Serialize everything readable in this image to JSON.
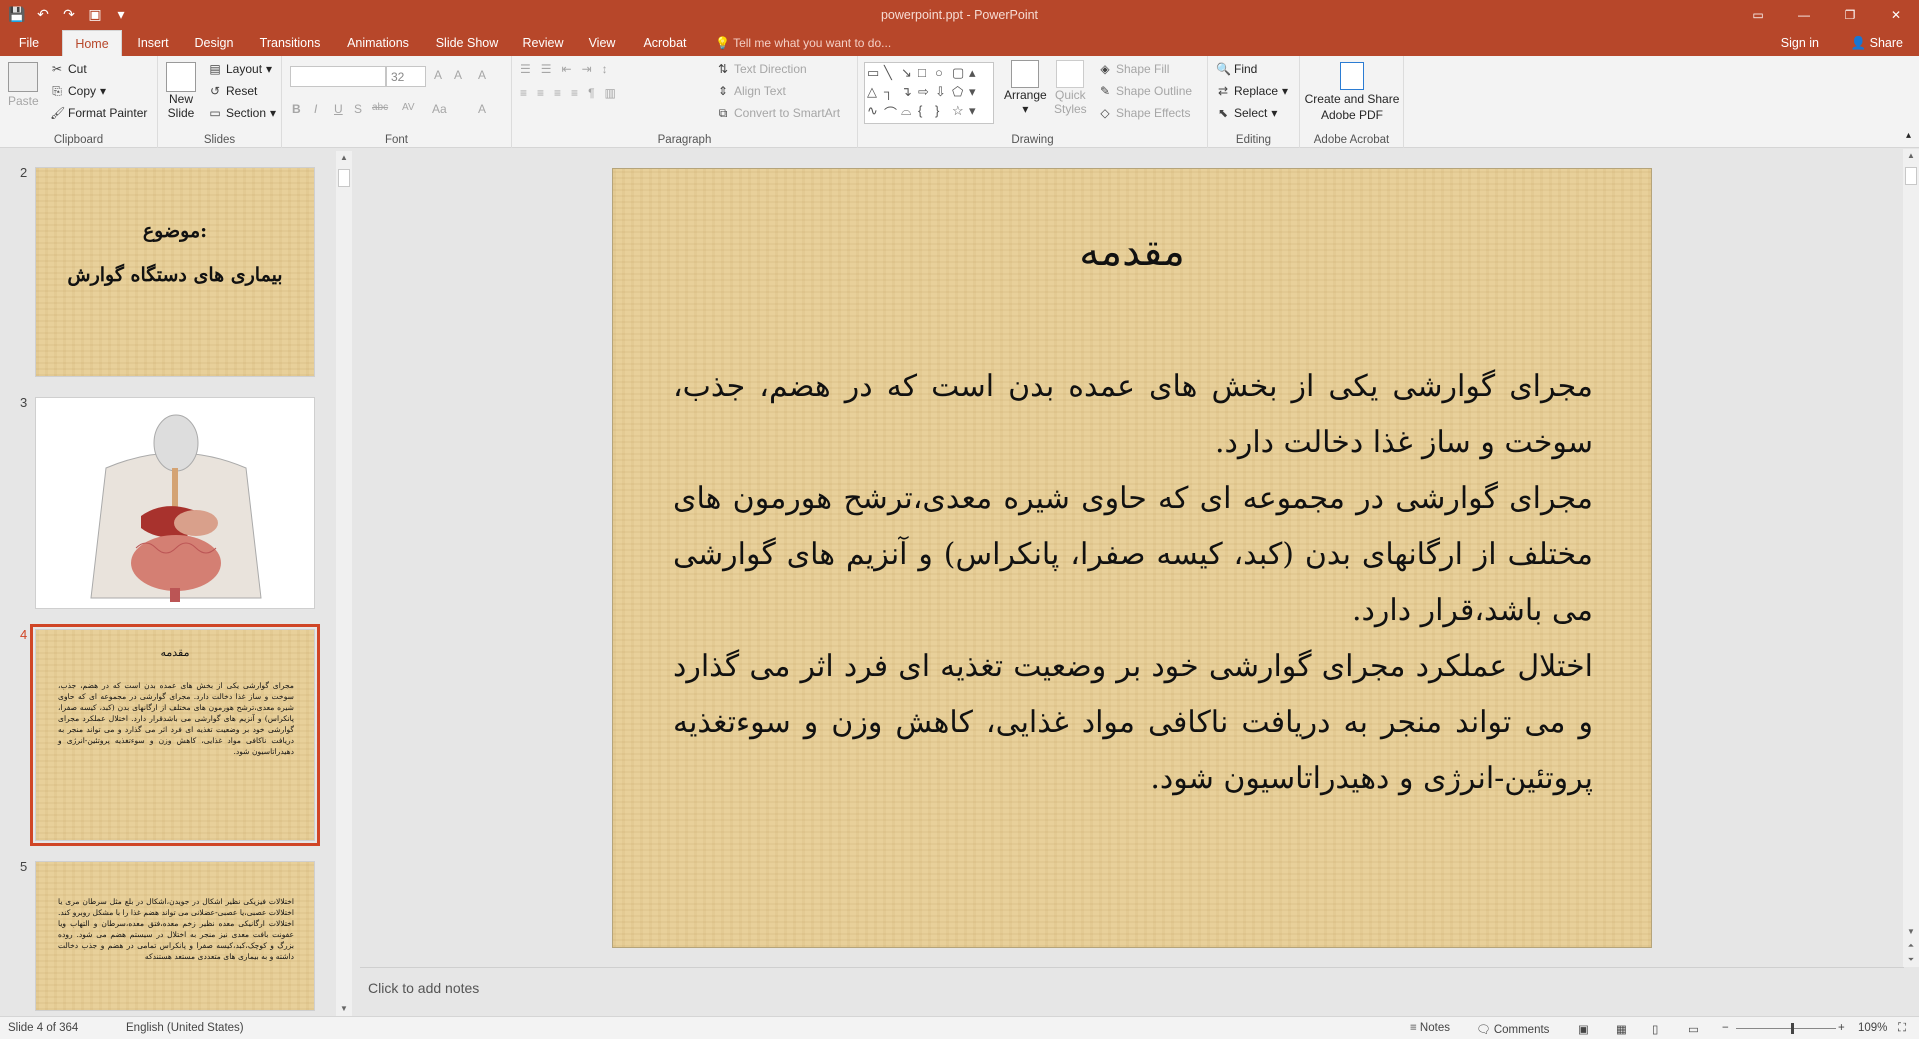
{
  "window": {
    "title": "powerpoint.ppt - PowerPoint"
  },
  "qat": {
    "save": "💾",
    "undo": "↶",
    "redo": "↷",
    "present": "▣",
    "more": "▾"
  },
  "winctl": {
    "ribbon_opts": "▭",
    "minimize": "—",
    "restore": "❐",
    "close": "✕"
  },
  "tabs": [
    "File",
    "Home",
    "Insert",
    "Design",
    "Transitions",
    "Animations",
    "Slide Show",
    "Review",
    "View",
    "Acrobat"
  ],
  "tellme": "Tell me what you want to do...",
  "signin": "Sign in",
  "share": "Share",
  "ribbon": {
    "clipboard": {
      "label": "Clipboard",
      "paste": "Paste",
      "cut": "Cut",
      "copy": "Copy",
      "format_painter": "Format Painter"
    },
    "slides": {
      "label": "Slides",
      "new_slide_1": "New",
      "new_slide_2": "Slide",
      "layout": "Layout",
      "reset": "Reset",
      "section": "Section"
    },
    "font": {
      "label": "Font",
      "font_name": "",
      "font_size": "32",
      "bold": "B",
      "italic": "I",
      "underline": "U",
      "strike": "S",
      "shadow": "abc",
      "spacing": "AV",
      "case": "Aa",
      "color": "A",
      "grow": "A",
      "shrink": "A",
      "clear": "A"
    },
    "paragraph": {
      "label": "Paragraph",
      "text_direction": "Text Direction",
      "align_text": "Align Text",
      "smartart": "Convert to SmartArt"
    },
    "drawing": {
      "label": "Drawing",
      "arrange": "Arrange",
      "quick_styles_1": "Quick",
      "quick_styles_2": "Styles",
      "shape_fill": "Shape Fill",
      "shape_outline": "Shape Outline",
      "shape_effects": "Shape Effects"
    },
    "editing": {
      "label": "Editing",
      "find": "Find",
      "replace": "Replace",
      "select": "Select"
    },
    "acrobat": {
      "label": "Adobe Acrobat",
      "create_1": "Create and Share",
      "create_2": "Adobe PDF"
    }
  },
  "thumbnails": [
    {
      "num": "2",
      "title": "موضوع:",
      "subtitle": "بیماری های دستگاه گوارش"
    },
    {
      "num": "3",
      "caption": "diagram"
    },
    {
      "num": "4",
      "title": "مقدمه",
      "body": "مجرای گوارشی یکی از بخش های عمده بدن است که در هضم، جذب، سوخت و ساز غذا دخالت دارد. مجرای گوارشی در مجموعه ای که حاوی شیره معدی،ترشح هورمون های مختلف از ارگانهای بدن (کبد، کیسه صفرا، پانکراس) و آنزیم های گوارشی می باشدقرار دارد. اختلال عملکرد مجرای گوارشی خود بر وضعیت تغذیه ای فرد اثر می گذارد و می تواند منجر به دریافت ناکافی مواد غذایی، کاهش وزن و سوءتغذیه پروتئین-انرژی و دهیدراتاسیون شود."
    },
    {
      "num": "5",
      "body": "اختلالات فیزیکی نظیر اشکال در جویدن،اشکال در بلع مثل سرطان مری یا اختلالات عصبی،یا عصبی-عضلانی می تواند هضم غذا را با مشکل روبرو کند. اختلالات ارگانیکی معده نظیر زخم معده،فتق معده،سرطان و التهاب ویا عفونت بافت معدی نیز منجر به اختلال در سیستم هضم می شود. روده بزرگ و کوچک،کبد،کیسه صفرا و پانکراس تمامی در هضم و جذب دخالت داشته و به بیماری های متعددی مستعد هستندکه"
    }
  ],
  "slide": {
    "title": "مقدمه",
    "paragraphs": [
      "مجرای گوارشی یکی از بخش های عمده بدن است که در هضم، جذب، سوخت و ساز غذا دخالت دارد.",
      "مجرای گوارشی در مجموعه ای که حاوی شیره معدی،ترشح هورمون های مختلف از ارگانهای بدن (کبد، کیسه صفرا، پانکراس) و آنزیم های گوارشی می باشد،قرار دارد.",
      "اختلال عملکرد مجرای گوارشی خود بر وضعیت تغذیه ای فرد اثر می گذارد و می تواند منجر به دریافت ناکافی مواد غذایی، کاهش وزن و سوءتغذیه پروتئین-انرژی و دهیدراتاسیون شود."
    ]
  },
  "notes_placeholder": "Click to add notes",
  "status": {
    "slide": "Slide 4 of 364",
    "language": "English (United States)",
    "notes": "Notes",
    "comments": "Comments",
    "zoom": "109%",
    "zoom_level": 0.55
  },
  "colors": {
    "accent": "#b7472a",
    "selection": "#d04526"
  }
}
